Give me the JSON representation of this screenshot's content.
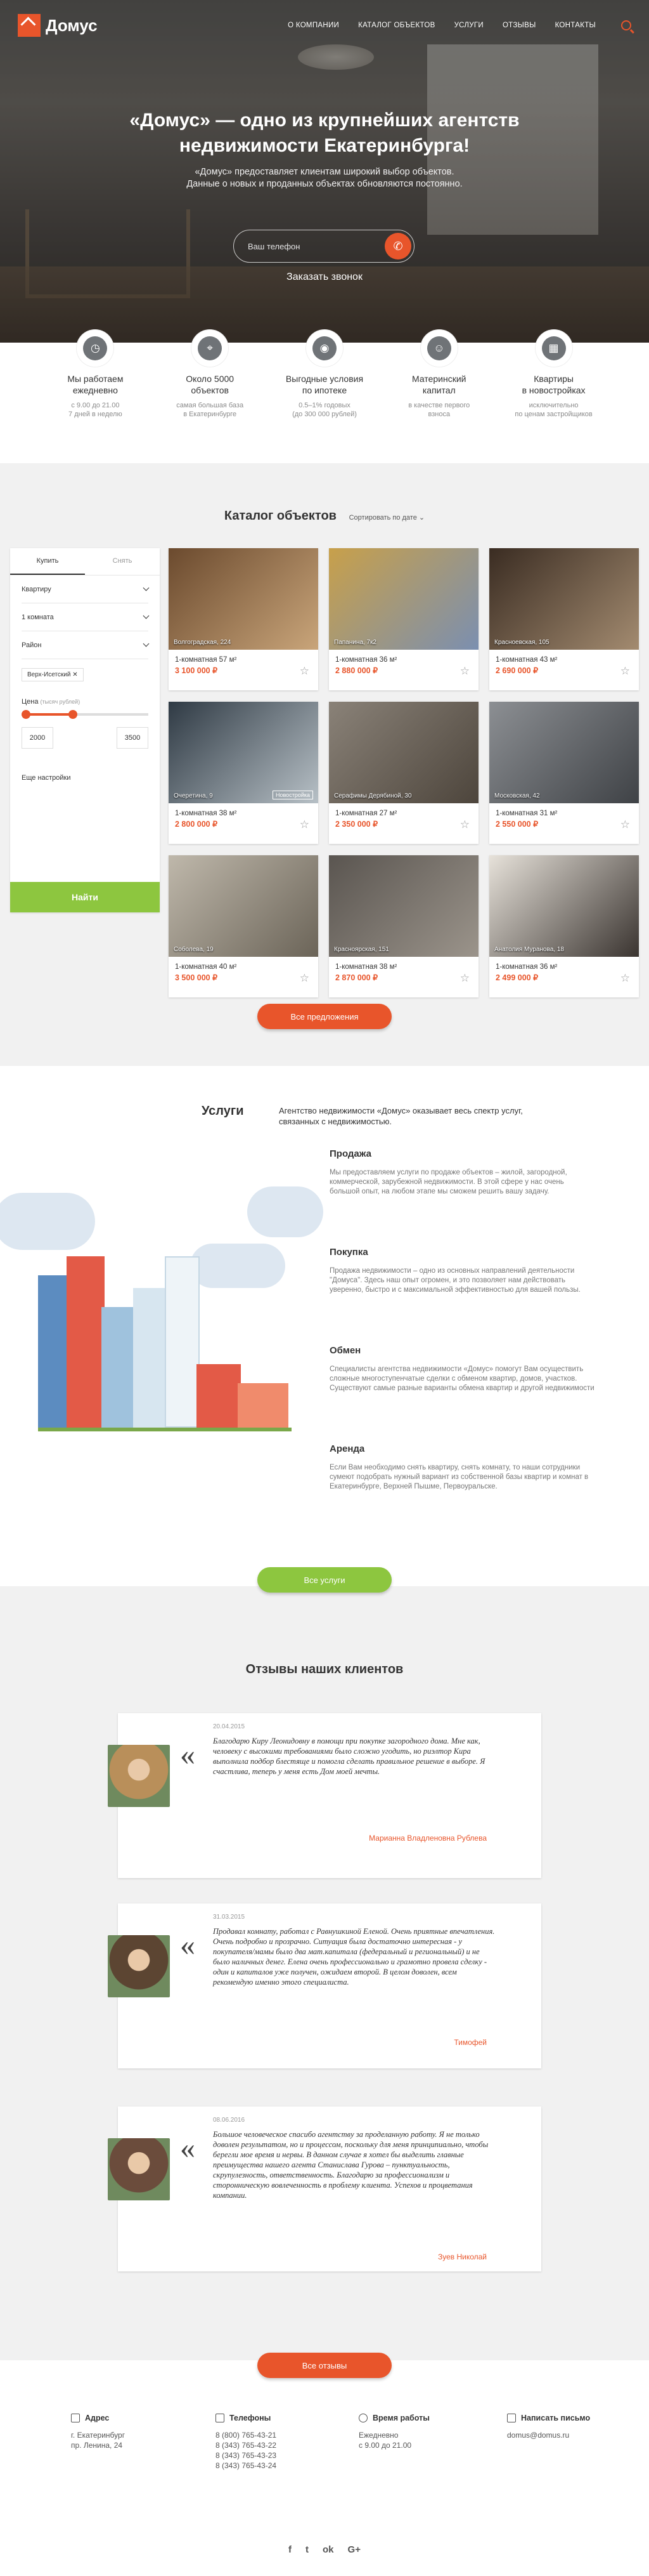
{
  "brand": {
    "name": "Домус",
    "accent": "#e8552b",
    "green": "#8dc63f"
  },
  "nav": {
    "items": [
      "О КОМПАНИИ",
      "КАТАЛОГ ОБЪЕКТОВ",
      "УСЛУГИ",
      "ОТЗЫВЫ",
      "КОНТАКТЫ"
    ]
  },
  "hero": {
    "title_line1": "«Домус» — одно из крупнейших агентств",
    "title_line2": "недвижимости Екатеринбурга!",
    "sub_line1": "«Домус» предоставляет клиентам широкий выбор объектов.",
    "sub_line2": "Данные о новых и проданных объектах обновляются постоянно.",
    "phone_placeholder": "Ваш телефон",
    "order_call": "Заказать звонок"
  },
  "features": [
    {
      "icon": "clock-icon",
      "title_l1": "Мы работаем",
      "title_l2": "ежедневно",
      "note_l1": "с 9.00 до 21.00",
      "note_l2": "7 дней в неделю"
    },
    {
      "icon": "map-pin-icon",
      "title_l1": "Около 5000",
      "title_l2": "объектов",
      "note_l1": "самая большая база",
      "note_l2": "в Екатеринбурге"
    },
    {
      "icon": "piggy-bank-icon",
      "title_l1": "Выгодные условия",
      "title_l2": "по ипотеке",
      "note_l1": "0.5–1% годовых",
      "note_l2": "(до 300 000 рублей)"
    },
    {
      "icon": "mother-icon",
      "title_l1": "Материнский",
      "title_l2": "капитал",
      "note_l1": "в качестве первого",
      "note_l2": "взноса"
    },
    {
      "icon": "building-icon",
      "title_l1": "Квартиры",
      "title_l2": "в новостройках",
      "note_l1": "исключительно",
      "note_l2": "по ценам застройщиков"
    }
  ],
  "catalog": {
    "title": "Каталог объектов",
    "sort": "Сортировать по дате",
    "tabs": [
      "Купить",
      "Снять"
    ],
    "selects": [
      "Квартиру",
      "1 комната",
      "Район"
    ],
    "district_tag": "Верх-Исетский",
    "price_label": "Цена",
    "price_unit": "(тысяч рублей)",
    "price_min": "2000",
    "price_max": "3500",
    "more_settings": "Еще настройки",
    "find": "Найти",
    "all_button": "Все предложения",
    "cards": [
      {
        "addr": "Волгоградская, 224",
        "title": "1-комнатная 57 м²",
        "price": "3 100 000 ₽",
        "badge": "",
        "c1": "#6b4a2e",
        "c2": "#c9a57a"
      },
      {
        "addr": "Папанина, 7к2",
        "title": "1-комнатная 36 м²",
        "price": "2 880 000 ₽",
        "badge": "",
        "c1": "#c8a04a",
        "c2": "#7b8fb0"
      },
      {
        "addr": "Красноевская, 105",
        "title": "1-комнатная 43 м²",
        "price": "2 690 000 ₽",
        "badge": "",
        "c1": "#3a2c22",
        "c2": "#a38b70"
      },
      {
        "addr": "Очеретина, 9",
        "title": "1-комнатная 38 м²",
        "price": "2 800 000 ₽",
        "badge": "Новостройка",
        "c1": "#2f3a44",
        "c2": "#b7c0c6"
      },
      {
        "addr": "Серафимы Дерябиной, 30",
        "title": "1-комнатная 27 м²",
        "price": "2 350 000 ₽",
        "badge": "",
        "c1": "#8a8278",
        "c2": "#4d453c"
      },
      {
        "addr": "Московская, 42",
        "title": "1-комнатная 31 м²",
        "price": "2 550 000 ₽",
        "badge": "",
        "c1": "#8c8f93",
        "c2": "#3f4246"
      },
      {
        "addr": "Соболева, 19",
        "title": "1-комнатная 40 м²",
        "price": "3 500 000 ₽",
        "badge": "",
        "c1": "#bfb8ab",
        "c2": "#6b6458"
      },
      {
        "addr": "Красноярская, 151",
        "title": "1-комнатная 38 м²",
        "price": "2 870 000 ₽",
        "badge": "",
        "c1": "#5a5550",
        "c2": "#9b948b"
      },
      {
        "addr": "Анатолия Муранова, 18",
        "title": "1-комнатная 36 м²",
        "price": "2 499 000 ₽",
        "badge": "",
        "c1": "#e7e2da",
        "c2": "#3a3430"
      }
    ]
  },
  "services": {
    "title": "Услуги",
    "intro": "Агентство недвижимости «Домус» оказывает весь спектр услуг, связанных с недвижимостью.",
    "items": [
      {
        "title": "Продажа",
        "text": "Мы предоставляем услуги по продаже объектов – жилой, загородной, коммерческой, зарубежной недвижимости. В этой сфере у нас очень большой опыт, на любом этапе мы сможем решить вашу задачу."
      },
      {
        "title": "Покупка",
        "text": "Продажа недвижимости – одно из основных направлений деятельности \"Домуса\". Здесь наш опыт огромен, и это позволяет нам действовать уверенно, быстро и с максимальной эффективностью для вашей пользы."
      },
      {
        "title": "Обмен",
        "text": "Специалисты агентства недвижимости «Домус» помогут Вам осуществить сложные многоступенчатые сделки с обменом квартир, домов, участков. Существуют самые разные варианты обмена квартир и другой недвижимости"
      },
      {
        "title": "Аренда",
        "text": "Если Вам необходимо снять квартиру, снять комнату, то наши сотрудники сумеют подобрать нужный вариант из собственной базы квартир и комнат в Екатеринбурге, Верхней Пышме, Первоуральске."
      }
    ],
    "button": "Все услуги"
  },
  "reviews": {
    "title": "Отзывы наших клиентов",
    "items": [
      {
        "date": "20.04.2015",
        "text": "Благодарю Киру Леонидовну в помощи при покупке загородного дома. Мне как, человеку с высокими требованиями было сложно угодить, но риэлтор Кира выполнила подбор блестяще и помогла сделать правильное решение в выборе. Я счастлива, теперь у меня есть Дом моей мечты.",
        "author": "Марианна Владленовна Рублева",
        "avatar": "#b98f5a"
      },
      {
        "date": "31.03.2015",
        "text": "Продавал комнату, работал с Равнушкиной Еленой. Очень приятные впечатления. Очень подробно и прозрачно. Ситуация была достаточно интересная - у покупателя/мамы было два мат.капитала (федеральный и региональный) и не было наличных денег. Елена очень профессионально и грамотно провела сделку - один и капиталов уже получен, ожидаем второй. В целом доволен, всем рекомендую именно этого специалиста.",
        "author": "Тимофей",
        "avatar": "#5c4532"
      },
      {
        "date": "08.06.2016",
        "text": "Большое человеческое спасибо агентству за проделанную работу. Я не только доволен результатом, но и процессом, поскольку для меня принципиально, чтобы берегли мое время и нервы. В данном случае я хотел бы выделить главные преимущества нашего агента Станислава Гурова – пунктуальность, скрупулезность, ответственность. Благодарю за профессионализм и сторонническую вовлеченность в проблему клиента. Успехов и процветания компании.",
        "author": "Зуев Николай",
        "avatar": "#6b4c3c"
      }
    ],
    "button": "Все отзывы"
  },
  "footer": {
    "address_title": "Адрес",
    "address_l1": "г. Екатеринбург",
    "address_l2": "пр. Ленина, 24",
    "phones_title": "Телефоны",
    "phones": [
      "8 (800) 765-43-21",
      "8 (343) 765-43-22",
      "8 (343) 765-43-23",
      "8 (343) 765-43-24"
    ],
    "hours_title": "Время работы",
    "hours_l1": "Ежедневно",
    "hours_l2": "с 9.00 до 21.00",
    "mail_title": "Написать письмо",
    "email": "domus@domus.ru",
    "social": [
      "f",
      "t",
      "ok",
      "G+"
    ]
  }
}
